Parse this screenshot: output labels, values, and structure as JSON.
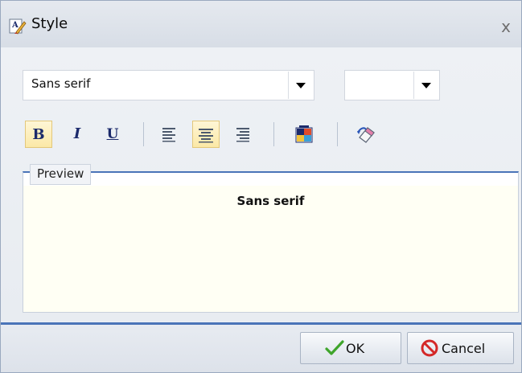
{
  "window": {
    "title": "Style",
    "close_glyph": "x",
    "title_icon": "style-brush-icon"
  },
  "font_select": {
    "value": "Sans serif",
    "icon": "chevron-down-icon"
  },
  "size_select": {
    "value": "",
    "icon": "chevron-down-icon"
  },
  "toolbar": {
    "bold": {
      "glyph": "B",
      "active": true
    },
    "italic": {
      "glyph": "I",
      "active": false
    },
    "underline": {
      "glyph": "U",
      "active": false
    },
    "align_left": {
      "icon": "align-left-icon",
      "active": false
    },
    "align_center": {
      "icon": "align-center-icon",
      "active": true
    },
    "align_right": {
      "icon": "align-right-icon",
      "active": false
    },
    "color": {
      "icon": "color-picker-icon"
    },
    "eraser": {
      "icon": "eraser-icon"
    }
  },
  "preview": {
    "legend": "Preview",
    "text": "Sans serif"
  },
  "buttons": {
    "ok": "OK",
    "cancel": "Cancel"
  },
  "colors": {
    "accent_line": "#4a74b8",
    "active_button": "#fbe8a6",
    "preview_background": "#fffff4",
    "ok_check": "#3fa52b",
    "cancel_icon": "#d42828"
  }
}
